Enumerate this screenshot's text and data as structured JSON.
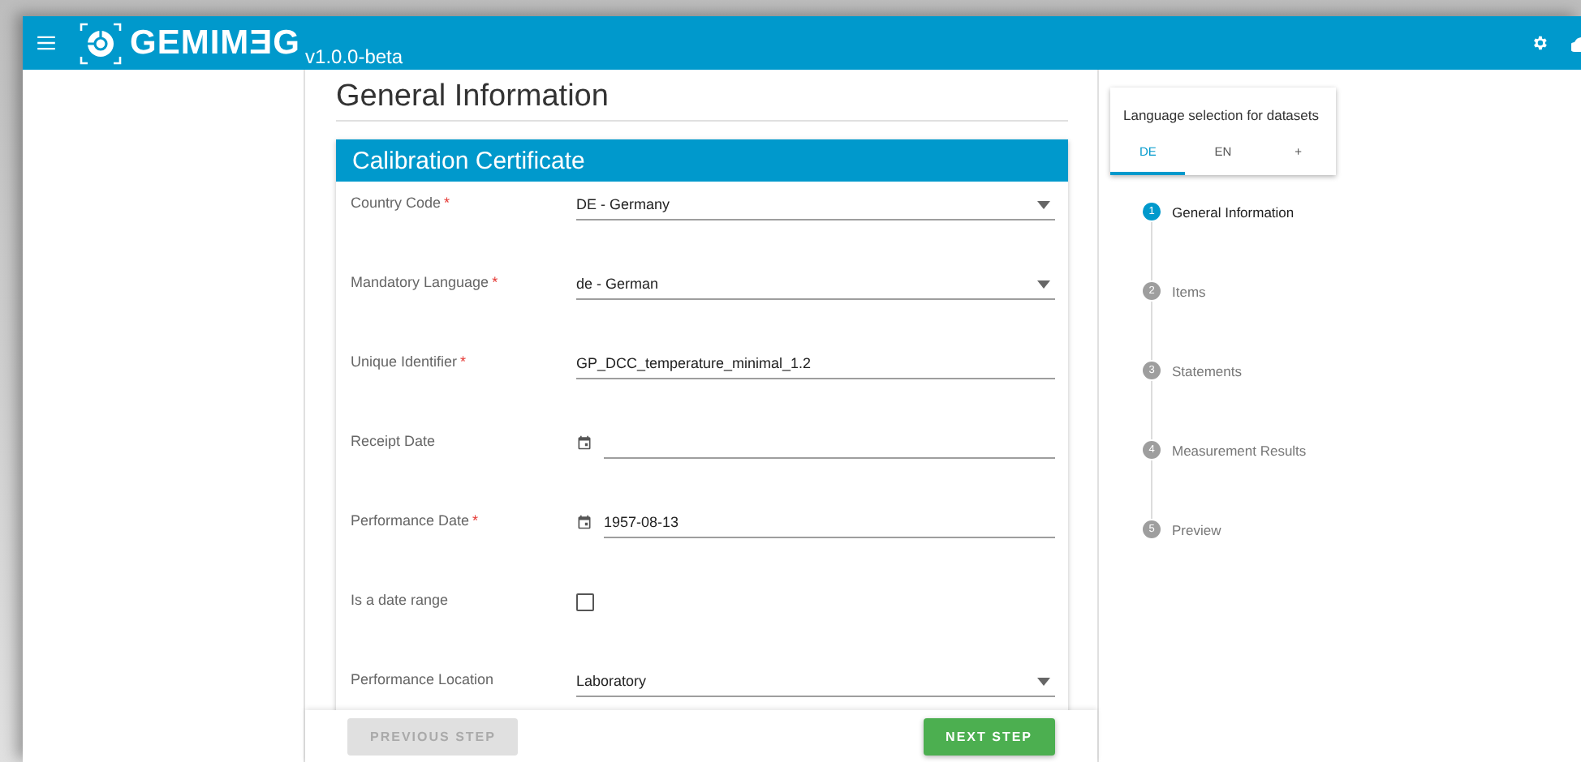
{
  "header": {
    "logo_text": "GEMIMƎG",
    "version": "v1.0.0-beta"
  },
  "page_title": "General Information",
  "card": {
    "title": "Calibration Certificate",
    "fields": [
      {
        "kind": "select",
        "label": "Country Code",
        "required_mark": "*",
        "value": "DE - Germany"
      },
      {
        "kind": "select",
        "label": "Mandatory Language",
        "required_mark": "*",
        "value": "de - German"
      },
      {
        "kind": "text",
        "label": "Unique Identifier",
        "required_mark": "*",
        "value": "GP_DCC_temperature_minimal_1.2"
      },
      {
        "kind": "date",
        "label": "Receipt Date"
      },
      {
        "kind": "date",
        "label": "Performance Date",
        "required_mark": "*",
        "value": "1957-08-13"
      },
      {
        "kind": "checkbox",
        "label": "Is a date range",
        "checked": false
      },
      {
        "kind": "select",
        "label": "Performance Location",
        "value": "Laboratory"
      }
    ]
  },
  "buttons": {
    "previous": {
      "label": "PREVIOUS STEP",
      "disabled": true
    },
    "next": {
      "label": "NEXT STEP",
      "disabled": false
    }
  },
  "language_panel": {
    "title": "Language selection for datasets",
    "tabs": [
      {
        "label": "DE",
        "selected": true
      },
      {
        "label": "EN",
        "selected": false
      },
      {
        "label": "+",
        "selected": false
      }
    ]
  },
  "steps": [
    {
      "number": "1",
      "label": "General Information",
      "selected": true
    },
    {
      "number": "2",
      "label": "Items",
      "selected": false
    },
    {
      "number": "3",
      "label": "Statements",
      "selected": false
    },
    {
      "number": "4",
      "label": "Measurement Results",
      "selected": false
    },
    {
      "number": "5",
      "label": "Preview",
      "selected": false
    }
  ]
}
